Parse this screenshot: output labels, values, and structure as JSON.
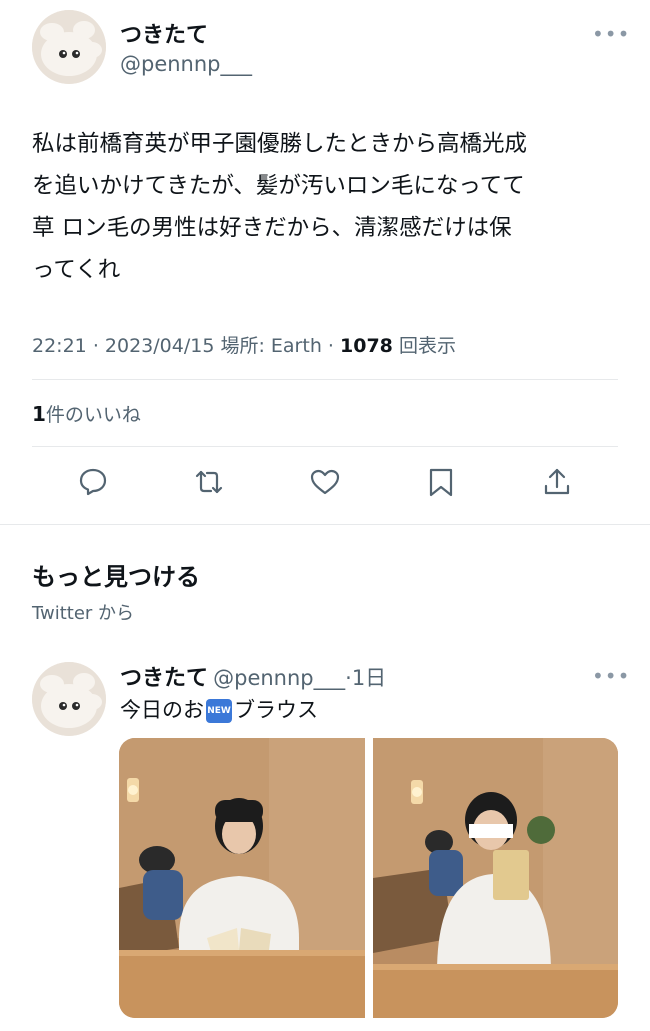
{
  "tweet": {
    "display_name": "つきたて",
    "handle": "@pennnp___",
    "more_icon": "…",
    "text_lines": [
      "私は前橋育英が甲子園優勝したときから高橋光成",
      "を追いかけてきたが、髪が汚いロン毛になってて",
      "草 ロン毛の男性は好きだから、清潔感だけは保",
      "ってくれ"
    ],
    "time": "22:21",
    "date": "2023/04/15",
    "location": "場所: Earth",
    "views_count": "1078",
    "views_label": "回表示",
    "likes_count": "1",
    "likes_label": "件のいいね"
  },
  "actions": [
    "reply-icon",
    "retweet-icon",
    "like-icon",
    "bookmark-icon",
    "share-icon"
  ],
  "discover": {
    "title": "もっと見つける",
    "source": "Twitter から"
  },
  "related_tweet": {
    "display_name": "つきたて",
    "handle": "@pennnp___",
    "time_ago": "1日",
    "text_before": "今日のお",
    "new_badge": "NEW",
    "text_after": "ブラウス"
  },
  "colors": {
    "text": "#0f1419",
    "secondary": "#536471",
    "divider": "#e7e9eb",
    "wood": "#c9a27a"
  }
}
